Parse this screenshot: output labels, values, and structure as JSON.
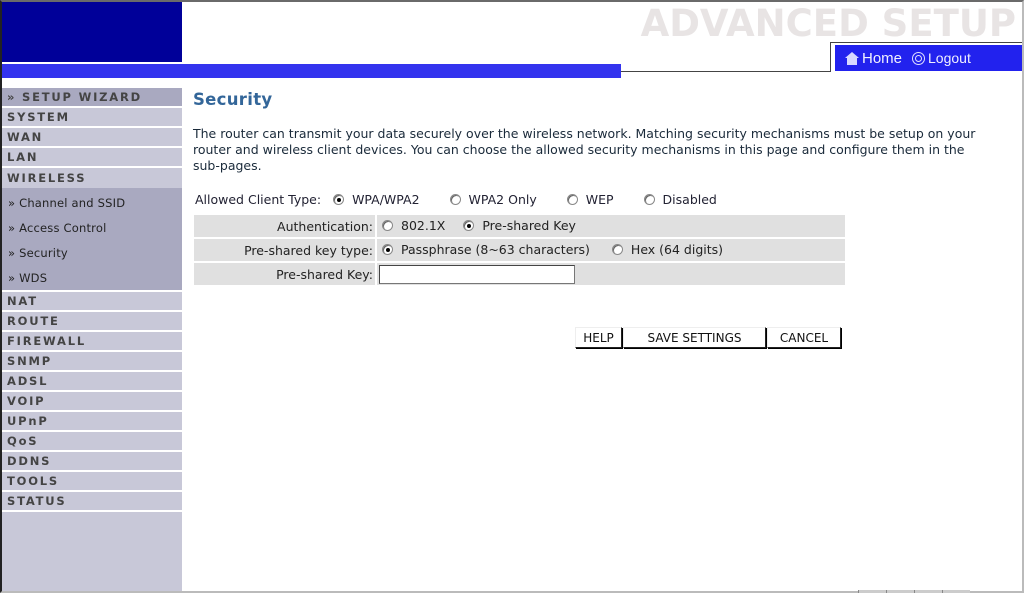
{
  "header": {
    "title": "ADVANCED SETUP",
    "nav": [
      {
        "label": "Home",
        "icon": "home-icon"
      },
      {
        "label": "Logout",
        "icon": "logout-icon"
      }
    ]
  },
  "sidebar": {
    "items": [
      {
        "label": "» SETUP WIZARD"
      },
      {
        "label": "SYSTEM"
      },
      {
        "label": "WAN"
      },
      {
        "label": "LAN"
      },
      {
        "label": "WIRELESS"
      }
    ],
    "wireless_sub": [
      {
        "label": "» Channel and SSID"
      },
      {
        "label": "» Access Control"
      },
      {
        "label": "» Security"
      },
      {
        "label": "» WDS"
      }
    ],
    "items_after": [
      {
        "label": "NAT"
      },
      {
        "label": "ROUTE"
      },
      {
        "label": "FIREWALL"
      },
      {
        "label": "SNMP"
      },
      {
        "label": "ADSL"
      },
      {
        "label": "VOIP"
      },
      {
        "label": "UPnP"
      },
      {
        "label": "QoS"
      },
      {
        "label": "DDNS"
      },
      {
        "label": "TOOLS"
      },
      {
        "label": "STATUS"
      }
    ]
  },
  "main": {
    "title": "Security",
    "intro": "The router can transmit your data securely over the wireless network. Matching security mechanisms must be setup on your router and wireless client devices. You can choose the allowed security mechanisms in this page and configure them in the sub-pages.",
    "client_type": {
      "label": "Allowed Client Type:",
      "options": [
        {
          "label": "WPA/WPA2",
          "selected": true
        },
        {
          "label": "WPA2 Only",
          "selected": false
        },
        {
          "label": "WEP",
          "selected": false
        },
        {
          "label": "Disabled",
          "selected": false
        }
      ]
    },
    "authentication": {
      "label": "Authentication:",
      "options": [
        {
          "label": "802.1X",
          "selected": false
        },
        {
          "label": "Pre-shared Key",
          "selected": true
        }
      ]
    },
    "psk_type": {
      "label": "Pre-shared key type:",
      "options": [
        {
          "label": "Passphrase (8~63 characters)",
          "selected": true
        },
        {
          "label": "Hex (64 digits)",
          "selected": false
        }
      ]
    },
    "psk": {
      "label": "Pre-shared Key:",
      "value": ""
    },
    "buttons": {
      "help": "HELP",
      "save": "SAVE SETTINGS",
      "cancel": "CANCEL"
    }
  },
  "colors": {
    "logo_bg": "#000099",
    "accent_bar": "#3333ee",
    "nav_bg": "#2222ee",
    "sidebar_bg": "#c8c8d8",
    "sidebar_active": "#a9a9c0",
    "title": "#336699"
  }
}
